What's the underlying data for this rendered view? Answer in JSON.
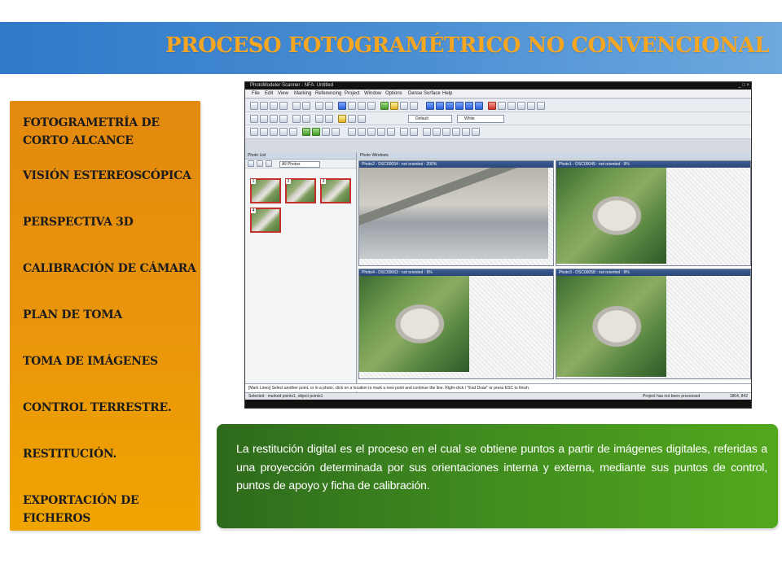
{
  "header": {
    "title": "PROCESO FOTOGRAMÉTRICO NO CONVENCIONAL",
    "bg_color": "#3d84cf",
    "title_color": "#f5a623"
  },
  "topics": {
    "bg_color": "#e9960b",
    "items": [
      "FOTOGRAMETRÍA DE CORTO ALCANCE",
      "VISIÓN ESTEREOSCÓPICA",
      "PERSPECTIVA 3D",
      "CALIBRACIÓN DE CÁMARA",
      "PLAN DE TOMA",
      "TOMA DE IMÁGENES",
      "CONTROL TERRESTRE.",
      "RESTITUCIÓN.",
      "EXPORTACIÓN DE FICHEROS"
    ]
  },
  "screenshot": {
    "window_title": "PhotoModeler Scanner - NFA: Untitled",
    "window_controls": "_ □ ×",
    "menu": [
      "File",
      "Edit",
      "View",
      "Marking",
      "Referencing",
      "Project",
      "Window",
      "Options",
      "Dense Surface",
      "Help"
    ],
    "toolbar": {
      "default_select": "Default",
      "white_select": "White"
    },
    "photo_list": {
      "title": "Photo List",
      "filter": "All Photos",
      "thumbnails": [
        "1",
        "2",
        "3",
        "4"
      ]
    },
    "photo_window": {
      "title": "Photo Windows",
      "panes": [
        {
          "label": "Photo2 - DSC00054 : not oriented : 200%"
        },
        {
          "label": "Photo1 - DSC00045 : not oriented : 9%"
        },
        {
          "label": "Photo4 - DSC00063 : not oriented : 9%"
        },
        {
          "label": "Photo3 - DSC00058 : not oriented : 9%"
        }
      ]
    },
    "status_line": "[Mark Lines] Select another point, or in a photo, click on a location to mark a new point and continue the line. Right-click / \"End Draw\" or press ESC to finish.",
    "status_bar": {
      "left": "Selected : marked points1, object points1",
      "right": "Project has not been processed",
      "coords": "1864, 842"
    }
  },
  "description": {
    "bg_color": "#3f8a1f",
    "text": "La restitución digital es el proceso en el cual se obtiene  puntos a partir de imágenes digitales, referidas a una proyección determinada por sus orientaciones interna y externa, mediante sus puntos de control, puntos de apoyo y ficha de calibración."
  }
}
